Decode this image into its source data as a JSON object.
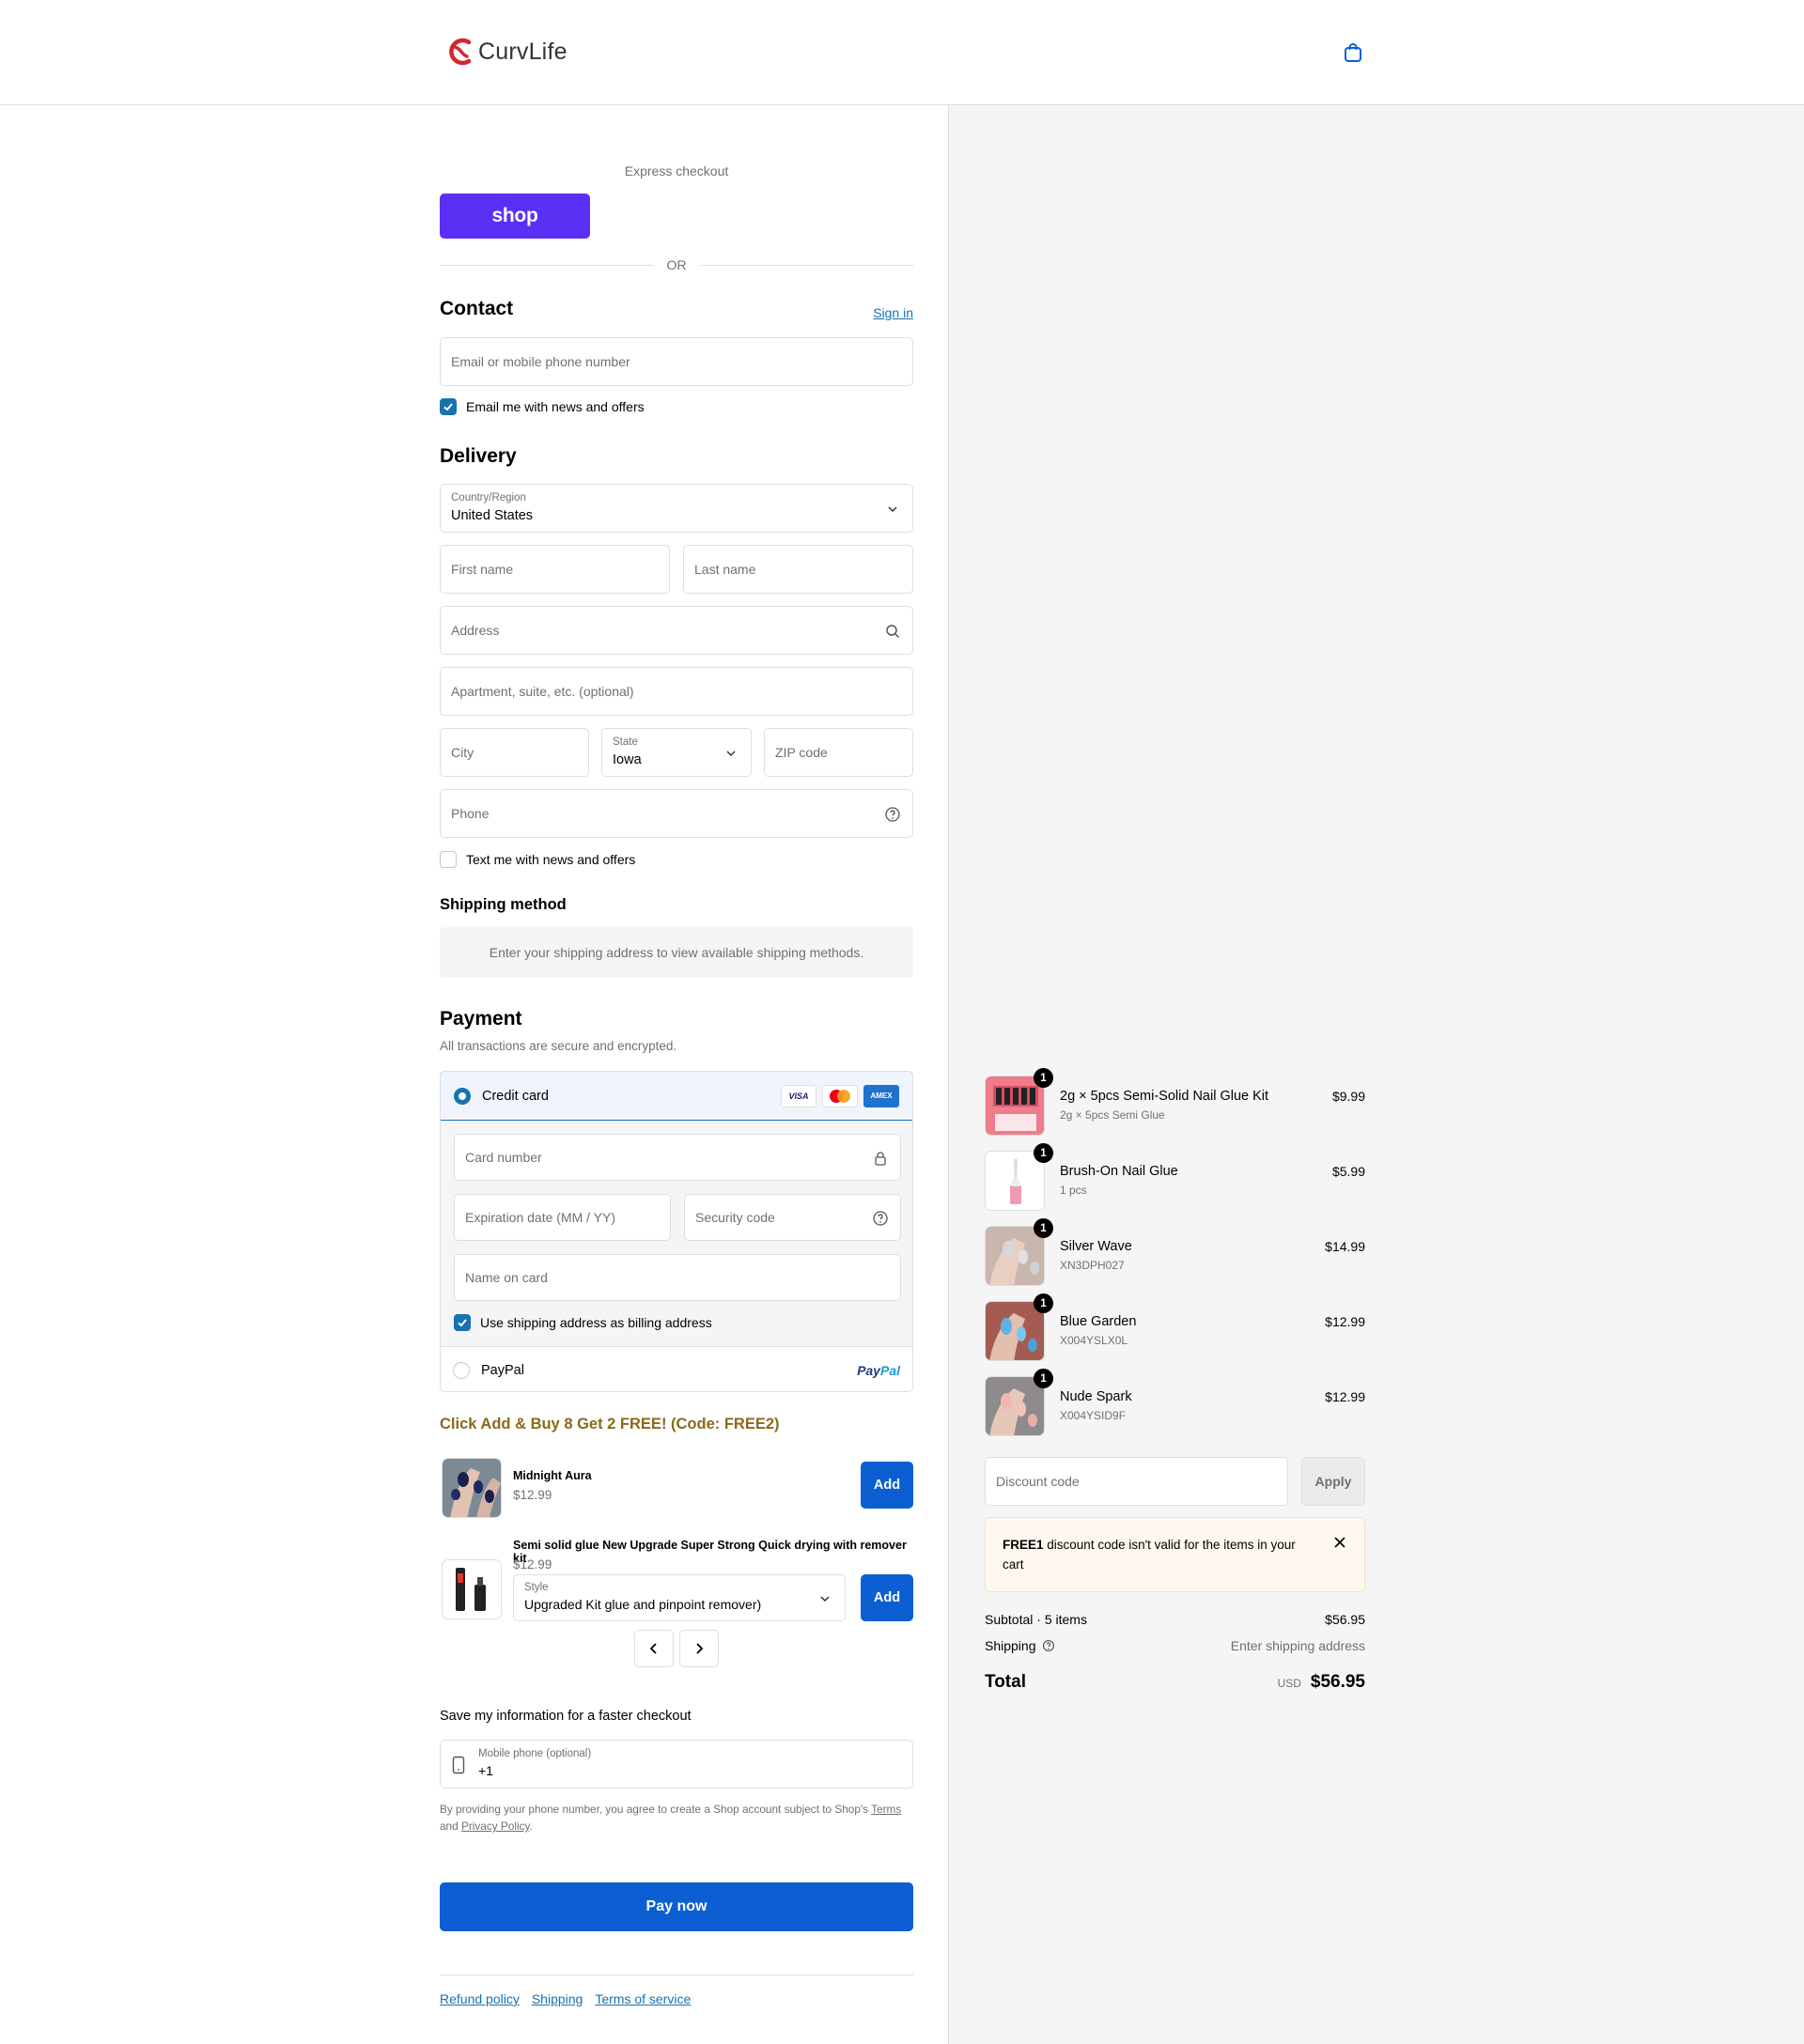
{
  "brand": {
    "name": "CurvLife",
    "accent": "#d6252f"
  },
  "colors": {
    "primary": "#0b5fd3",
    "link": "#1773b0",
    "shop_purple": "#5a31f4",
    "promo": "#8a6a1a"
  },
  "header": {
    "cart_icon": "shopping-bag-icon"
  },
  "express": {
    "label": "Express checkout",
    "shop_button": "shop",
    "or": "OR"
  },
  "contact": {
    "title": "Contact",
    "sign_in": "Sign in",
    "email_placeholder": "Email or mobile phone number",
    "news_label": "Email me with news and offers",
    "news_checked": true
  },
  "delivery": {
    "title": "Delivery",
    "country_label": "Country/Region",
    "country_value": "United States",
    "first_name": "First name",
    "last_name": "Last name",
    "address": "Address",
    "apartment": "Apartment, suite, etc. (optional)",
    "city": "City",
    "state_label": "State",
    "state_value": "Iowa",
    "zip": "ZIP code",
    "phone": "Phone",
    "text_label": "Text me with news and offers",
    "text_checked": false
  },
  "shipping_method": {
    "title": "Shipping method",
    "note": "Enter your shipping address to view available shipping methods."
  },
  "payment": {
    "title": "Payment",
    "subtitle": "All transactions are secure and encrypted.",
    "credit_card": "Credit card",
    "card_brands": [
      "VISA",
      "Mastercard",
      "AMEX"
    ],
    "card_number": "Card number",
    "expiration": "Expiration date (MM / YY)",
    "security": "Security code",
    "name_on_card": "Name on card",
    "billing_label": "Use shipping address as billing address",
    "billing_checked": true,
    "paypal": "PayPal",
    "paypal_logo_a": "Pay",
    "paypal_logo_b": "Pal"
  },
  "promo": {
    "title": "Click Add & Buy 8 Get 2 FREE! (Code: FREE2)",
    "items": [
      {
        "name": "Midnight Aura",
        "price": "$12.99",
        "button": "Add"
      },
      {
        "name": "Semi solid glue New Upgrade Super Strong Quick drying with remover kit",
        "price": "$12.99",
        "style_label": "Style",
        "style_value": "Upgraded Kit glue and pinpoint remover)",
        "button": "Add"
      }
    ]
  },
  "save_info": {
    "title": "Save my information for a faster checkout",
    "phone_label": "Mobile phone (optional)",
    "phone_value": "+1",
    "disclaimer_a": "By providing your phone number, you agree to create a Shop account subject to Shop's",
    "terms": "Terms",
    "and": "and",
    "privacy": "Privacy Policy",
    "period": "."
  },
  "pay_now": "Pay now",
  "footer": {
    "links": [
      "Refund policy",
      "Shipping",
      "Terms of service"
    ]
  },
  "cart": {
    "items": [
      {
        "qty": "1",
        "name": "2g × 5pcs Semi-Solid Nail Glue Kit",
        "variant": "2g × 5pcs Semi Glue",
        "price": "$9.99"
      },
      {
        "qty": "1",
        "name": "Brush-On Nail Glue",
        "variant": "1 pcs",
        "price": "$5.99"
      },
      {
        "qty": "1",
        "name": "Silver Wave",
        "variant": "XN3DPH027",
        "price": "$14.99"
      },
      {
        "qty": "1",
        "name": "Blue Garden",
        "variant": "X004YSLX0L",
        "price": "$12.99"
      },
      {
        "qty": "1",
        "name": "Nude Spark",
        "variant": "X004YSID9F",
        "price": "$12.99"
      }
    ],
    "discount_placeholder": "Discount code",
    "apply": "Apply",
    "warning_code": "FREE1",
    "warning_text": "discount code isn't valid for the items in your cart",
    "subtotal_label": "Subtotal · 5 items",
    "subtotal": "$56.95",
    "shipping_label": "Shipping",
    "shipping_value": "Enter shipping address",
    "total_label": "Total",
    "currency": "USD",
    "total": "$56.95"
  }
}
